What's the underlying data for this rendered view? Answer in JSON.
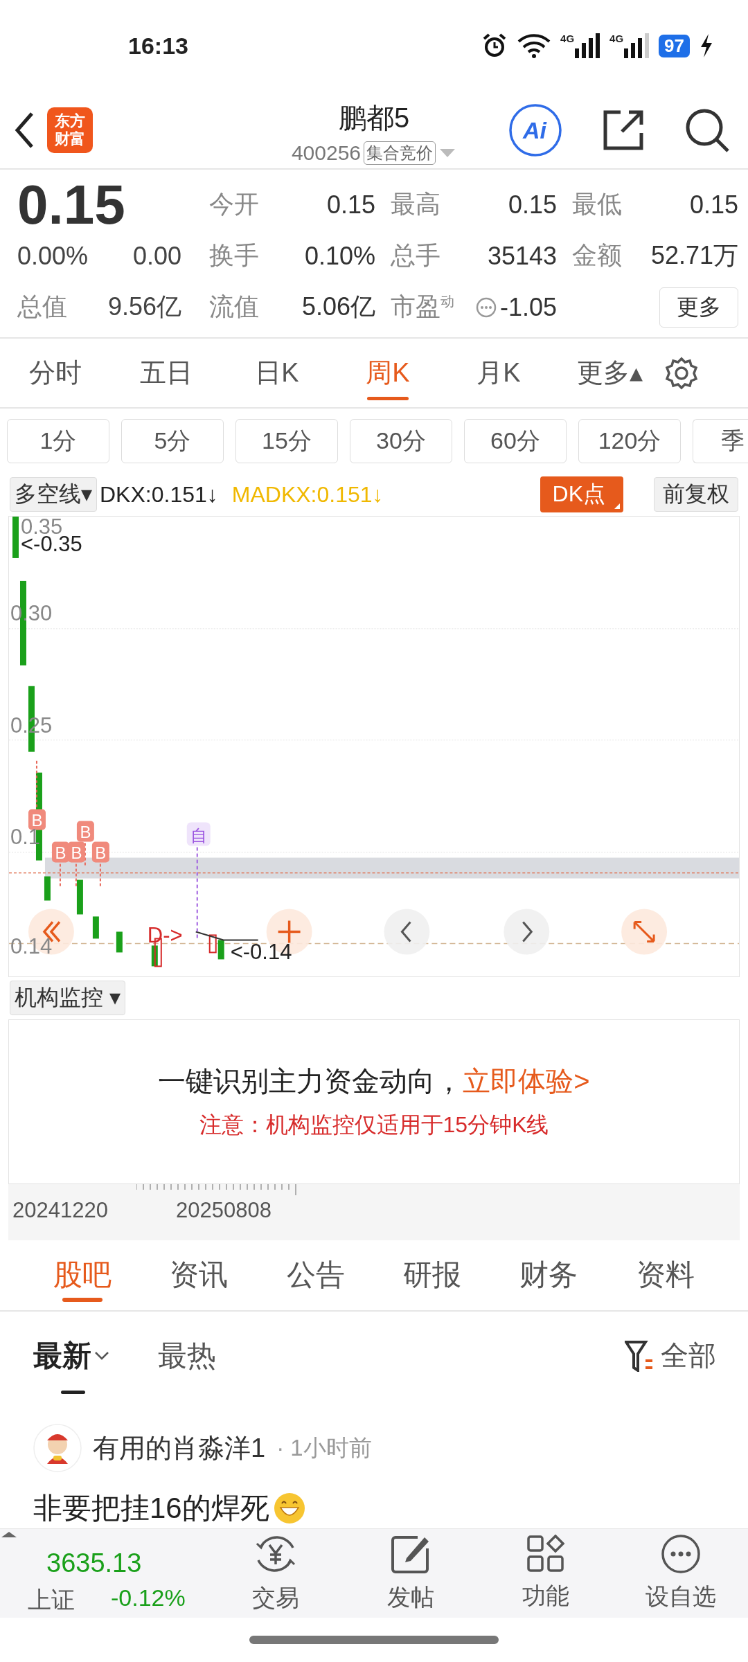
{
  "status_bar": {
    "time": "16:13",
    "networks": [
      "4G",
      "4G"
    ],
    "battery": "97"
  },
  "header": {
    "logo_lines": [
      "东方",
      "财富"
    ],
    "title": "鹏都5",
    "code": "400256",
    "tag": "集合竞价",
    "ai_label": "Ai"
  },
  "quote": {
    "price": "0.15",
    "change_pct": "0.00%",
    "change": "0.00",
    "total_value": {
      "label": "总值",
      "value": "9.56亿"
    },
    "stats": [
      {
        "label": "今开",
        "value": "0.15"
      },
      {
        "label": "最高",
        "value": "0.15"
      },
      {
        "label": "最低",
        "value": "0.15"
      },
      {
        "label": "换手",
        "value": "0.10%"
      },
      {
        "label": "总手",
        "value": "35143"
      },
      {
        "label": "金额",
        "value": "52.71万"
      },
      {
        "label": "流值",
        "value": "5.06亿"
      },
      {
        "label": "市盈$^{动}$",
        "value": "-1.05",
        "kind": "info"
      }
    ],
    "more_button": "更多"
  },
  "period_tabs": [
    {
      "label": "分时",
      "selected": false
    },
    {
      "label": "五日",
      "selected": false
    },
    {
      "label": "日K",
      "selected": false
    },
    {
      "label": "周K",
      "selected": true
    },
    {
      "label": "月K",
      "selected": false
    },
    {
      "label": "更多▴",
      "selected": false
    }
  ],
  "intervals": [
    "1分",
    "5分",
    "15分",
    "30分",
    "60分",
    "120分",
    "季"
  ],
  "indicator": {
    "dropdown": "多空线▾",
    "dkx": "DKX:0.151↓",
    "madkx": "MADKX:0.151↓",
    "dk_button": "DK点",
    "adjust_button": "前复权"
  },
  "chart": {
    "y_labels": [
      "0.35",
      "0.30",
      "0.25",
      "0.1",
      "0.14"
    ],
    "high_marker": "<-0.35",
    "low_marker": "<-0.14",
    "buy_marks": [
      "B",
      "B",
      "B",
      "B",
      "B"
    ],
    "self_mark": "自",
    "d_marker": "D->"
  },
  "monitor": {
    "dropdown": "机构监控 ▾",
    "promo_text": "一键识别主力资金动向，",
    "promo_link": "立即体验>",
    "notice": "注意：机构监控仅适用于15分钟K线"
  },
  "dates": [
    "20241220",
    "20250808"
  ],
  "section_tabs": [
    {
      "label": "股吧",
      "selected": true
    },
    {
      "label": "资讯",
      "selected": false
    },
    {
      "label": "公告",
      "selected": false
    },
    {
      "label": "研报",
      "selected": false
    },
    {
      "label": "财务",
      "selected": false
    },
    {
      "label": "资料",
      "selected": false
    }
  ],
  "sort_tabs": [
    {
      "label": "最新",
      "selected": true
    },
    {
      "label": "最热",
      "selected": false
    }
  ],
  "filter": "全部",
  "post": {
    "user": "有用的肖淼洋1",
    "time": "· 1小时前",
    "text": "非要把挂16的焊死"
  },
  "index": {
    "value": "3635.13",
    "name": "上证",
    "change": "-0.12%"
  },
  "nav": [
    {
      "label": "交易",
      "kind": "trade"
    },
    {
      "label": "发帖",
      "kind": "post"
    },
    {
      "label": "功能",
      "kind": "apps"
    },
    {
      "label": "设自选",
      "kind": "more"
    }
  ]
}
